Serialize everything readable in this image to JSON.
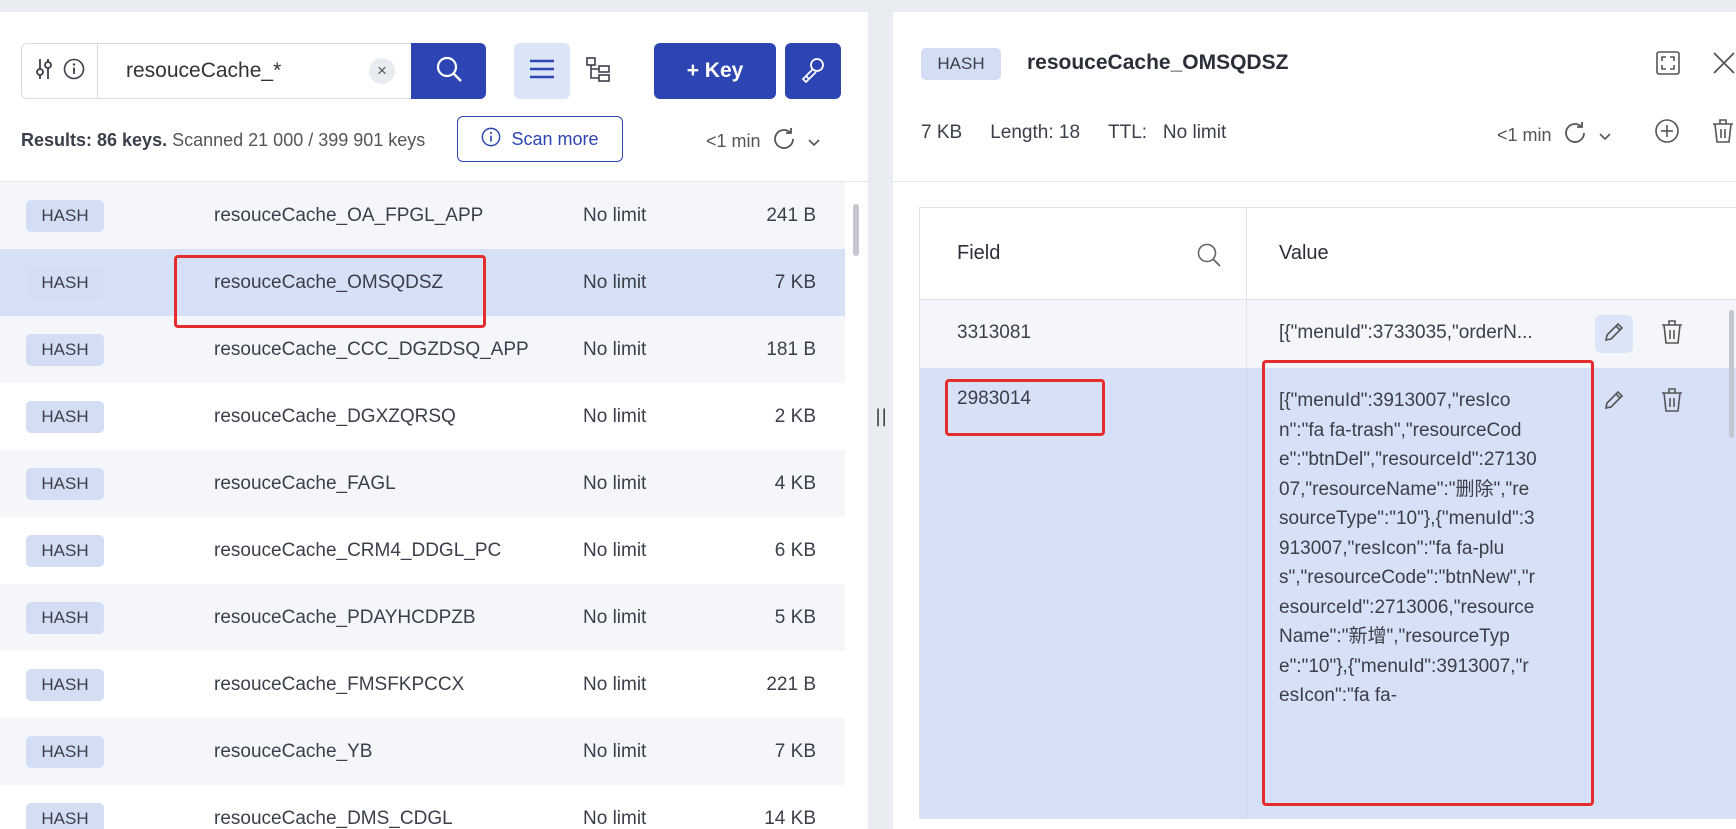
{
  "search": {
    "query": "resouceCache_*",
    "clear_glyph": "×"
  },
  "toolbar": {
    "add_key_label": "+ Key"
  },
  "results": {
    "summary_bold": "Results: 86 keys.",
    "summary_rest": " Scanned 21 000 / 399 901 keys",
    "scan_more_label": "Scan more",
    "refresh_age": "<1 min"
  },
  "keys": [
    {
      "type": "HASH",
      "name": "resouceCache_OA_FPGL_APP",
      "ttl": "No limit",
      "size": "241 B"
    },
    {
      "type": "HASH",
      "name": "resouceCache_OMSQDSZ",
      "ttl": "No limit",
      "size": "7 KB"
    },
    {
      "type": "HASH",
      "name": "resouceCache_CCC_DGZDSQ_APP",
      "ttl": "No limit",
      "size": "181 B"
    },
    {
      "type": "HASH",
      "name": "resouceCache_DGXZQRSQ",
      "ttl": "No limit",
      "size": "2 KB"
    },
    {
      "type": "HASH",
      "name": "resouceCache_FAGL",
      "ttl": "No limit",
      "size": "4 KB"
    },
    {
      "type": "HASH",
      "name": "resouceCache_CRM4_DDGL_PC",
      "ttl": "No limit",
      "size": "6 KB"
    },
    {
      "type": "HASH",
      "name": "resouceCache_PDAYHCDPZB",
      "ttl": "No limit",
      "size": "5 KB"
    },
    {
      "type": "HASH",
      "name": "resouceCache_FMSFKPCCX",
      "ttl": "No limit",
      "size": "221 B"
    },
    {
      "type": "HASH",
      "name": "resouceCache_YB",
      "ttl": "No limit",
      "size": "7 KB"
    },
    {
      "type": "HASH",
      "name": "resouceCache_DMS_CDGL",
      "ttl": "No limit",
      "size": "14 KB"
    }
  ],
  "splitter_glyph": "||",
  "detail": {
    "type": "HASH",
    "key_name": "resouceCache_OMSQDSZ",
    "size": "7 KB",
    "length": "Length: 18",
    "ttl_label": "TTL:",
    "ttl_value": "No limit",
    "refresh_age": "<1 min",
    "columns": {
      "field": "Field",
      "value": "Value"
    },
    "rows": [
      {
        "field": "3313081",
        "value": "[{\"menuId\":3733035,\"orderN..."
      },
      {
        "field": "2983014",
        "value": "[{\"menuId\":3913007,\"resIcon\":\"fa fa-trash\",\"resourceCode\":\"btnDel\",\"resourceId\":2713007,\"resourceName\":\"删除\",\"resourceType\":\"10\"},{\"menuId\":3913007,\"resIcon\":\"fa fa-plus\",\"resourceCode\":\"btnNew\",\"resourceId\":2713006,\"resourceName\":\"新增\",\"resourceType\":\"10\"},{\"menuId\":3913007,\"resIcon\":\"fa fa-"
      }
    ]
  }
}
